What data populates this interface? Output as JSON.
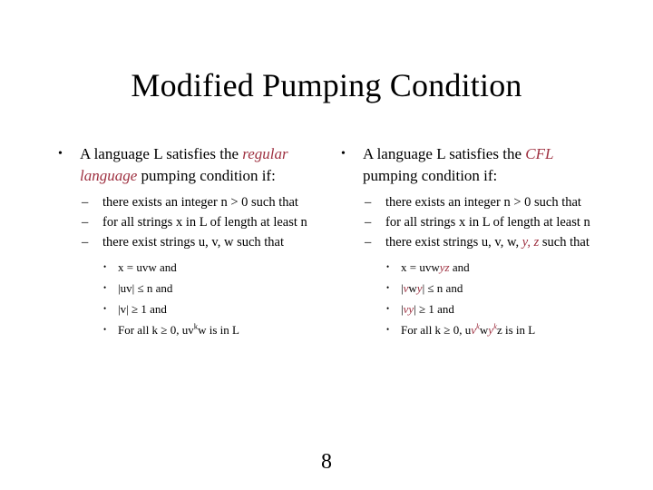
{
  "slide": {
    "title": "Modified Pumping Condition",
    "page_number": "8",
    "accent_color": "#9e3040",
    "background_color": "#ffffff",
    "bullet_glyphs": {
      "level1": "•",
      "level2": "–",
      "level3": "•"
    }
  },
  "left_column": {
    "heading": {
      "part1": "A language L satisfies the ",
      "emphasis": "regular language",
      "part2": " pumping condition if:"
    },
    "sub_bullets": [
      "there exists an integer n > 0 such that",
      "for all strings x in L of length at least n",
      "there exist strings u, v, w such that"
    ],
    "conditions": [
      {
        "pre": "x = uvw and",
        "mid": "",
        "post": ""
      },
      {
        "pre": "|uv| ≤ n and",
        "mid": "",
        "post": ""
      },
      {
        "pre": "|v| ≥ 1 and",
        "mid": "",
        "post": ""
      },
      {
        "pre": "For all k ≥ 0, uv",
        "sup": "k",
        "post": "w is in L"
      }
    ]
  },
  "right_column": {
    "heading": {
      "part1": "A language L satisfies the ",
      "emphasis": "CFL",
      "part2": " pumping condition if:"
    },
    "sub_bullets": [
      {
        "text": "there exists an integer n > 0 such that",
        "emphasis": ""
      },
      {
        "text": "for all strings x in L of length at least n",
        "emphasis": ""
      },
      {
        "prefix": "there exist strings u, v, w, ",
        "emphasis": "y, z",
        "suffix": " such that"
      }
    ],
    "conditions": [
      {
        "p1": "x = uvw",
        "e1": "yz",
        "p2": " and"
      },
      {
        "p1": "|",
        "e1": "v",
        "p2": "w",
        "e2": "y",
        "p3": "| ≤ n and"
      },
      {
        "p1": "|",
        "e1": "vy",
        "p2": "| ≥ 1 and"
      },
      {
        "p1": "For all k ≥ 0, u",
        "e1": "v",
        "e1sup": "k",
        "p2": "w",
        "e2": "y",
        "e2sup": "k",
        "p3": "z is in L"
      }
    ]
  }
}
